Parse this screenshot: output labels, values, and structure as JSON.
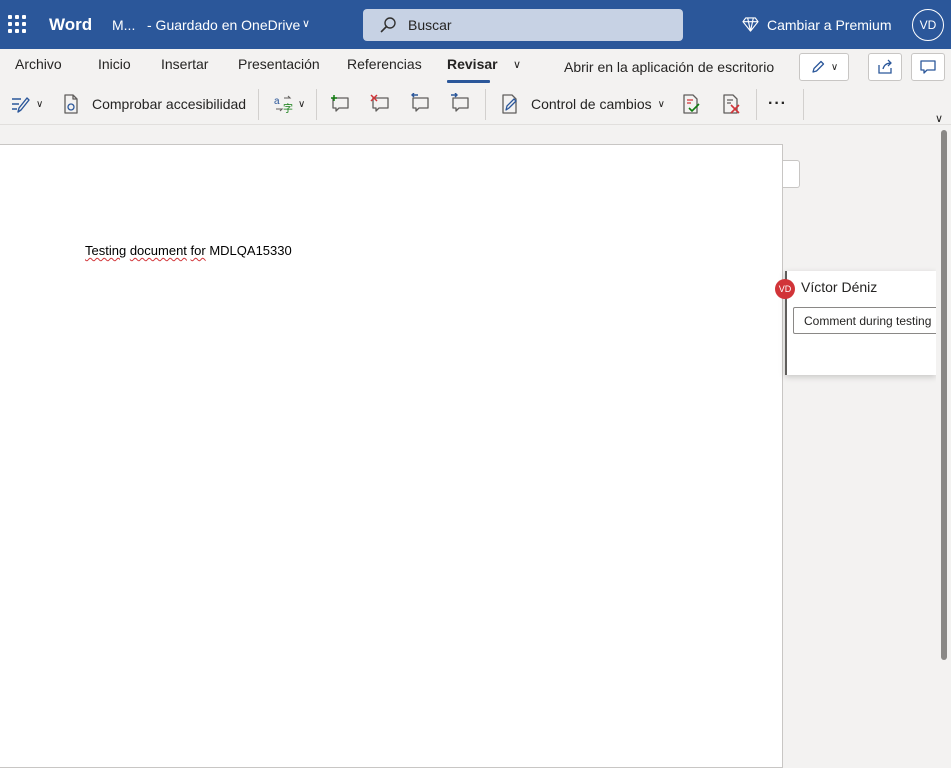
{
  "titlebar": {
    "app_name": "Word",
    "doc_name": "M...",
    "save_status": "- Guardado en OneDrive",
    "search_placeholder": "Buscar",
    "premium_label": "Cambiar a Premium",
    "user_initials": "VD"
  },
  "tabs": [
    {
      "label": "Archivo"
    },
    {
      "label": "Inicio"
    },
    {
      "label": "Insertar"
    },
    {
      "label": "Presentación"
    },
    {
      "label": "Referencias"
    },
    {
      "label": "Revisar",
      "active": true
    }
  ],
  "open_desktop_label": "Abrir en la aplicación de escritorio",
  "toolbar": {
    "accessibility_label": "Comprobar accesibilidad",
    "track_changes_label": "Control de cambios",
    "more_label": "···"
  },
  "document": {
    "text_part1": "Testing",
    "text_part2": "document",
    "text_part3": "for",
    "text_part4": "MDLQA15330"
  },
  "comment": {
    "author_initials": "VD",
    "author_name": "Víctor Déniz",
    "draft_text": "Comment during testing"
  },
  "colors": {
    "brand": "#2b579a",
    "avatar_red": "#d13438"
  }
}
